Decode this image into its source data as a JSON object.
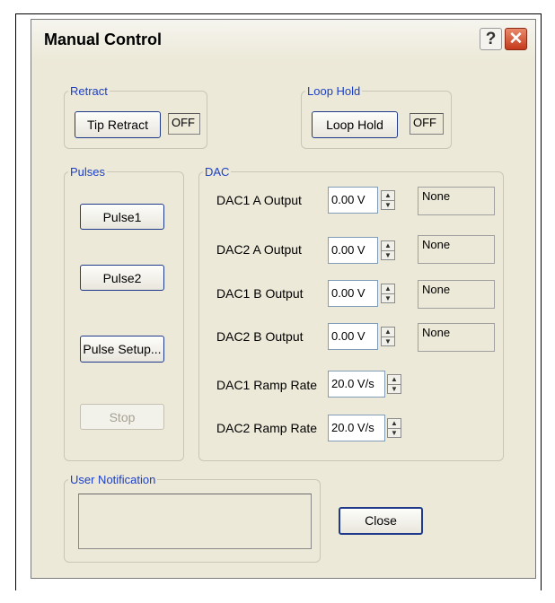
{
  "window": {
    "title": "Manual Control"
  },
  "retract": {
    "legend": "Retract",
    "button": "Tip Retract",
    "status": "OFF"
  },
  "loop_hold": {
    "legend": "Loop Hold",
    "button": "Loop Hold",
    "status": "OFF"
  },
  "pulses": {
    "legend": "Pulses",
    "pulse1": "Pulse1",
    "pulse2": "Pulse2",
    "setup": "Pulse Setup...",
    "stop": "Stop"
  },
  "dac": {
    "legend": "DAC",
    "rows": [
      {
        "label": "DAC1 A Output",
        "value": "0.00 V",
        "status": "None"
      },
      {
        "label": "DAC2 A Output",
        "value": "0.00 V",
        "status": "None"
      },
      {
        "label": "DAC1 B Output",
        "value": "0.00 V",
        "status": "None"
      },
      {
        "label": "DAC2 B Output",
        "value": "0.00 V",
        "status": "None"
      },
      {
        "label": "DAC1 Ramp Rate",
        "value": "20.0 V/s"
      },
      {
        "label": "DAC2 Ramp Rate",
        "value": "20.0 V/s"
      }
    ]
  },
  "notification": {
    "legend": "User Notification",
    "text": ""
  },
  "close_label": "Close",
  "colors": {
    "legend_blue": "#1c3fc6",
    "window_bg": "#ece9d8",
    "button_border": "#1f3a8a"
  }
}
